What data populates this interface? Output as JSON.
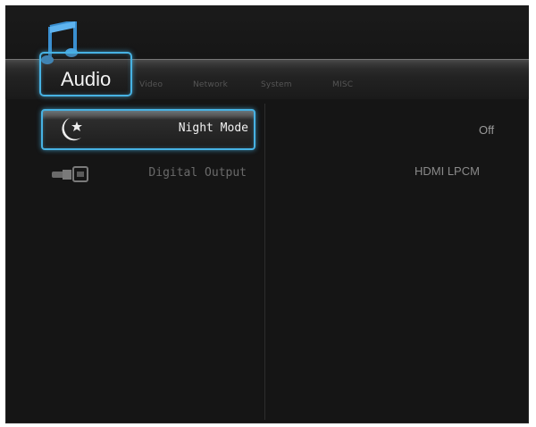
{
  "tabs": [
    {
      "label": "Audio",
      "active": true
    },
    {
      "label": "Video",
      "active": false
    },
    {
      "label": "Network",
      "active": false
    },
    {
      "label": "System",
      "active": false
    },
    {
      "label": "MISC",
      "active": false
    }
  ],
  "settings": [
    {
      "label": "Night Mode",
      "value": "Off",
      "icon": "moon-star-icon",
      "selected": true
    },
    {
      "label": "Digital Output",
      "value": "HDMI LPCM",
      "icon": "hdmi-cable-icon",
      "selected": false
    }
  ],
  "colors": {
    "accent": "#47b2e3",
    "background": "#151515"
  }
}
